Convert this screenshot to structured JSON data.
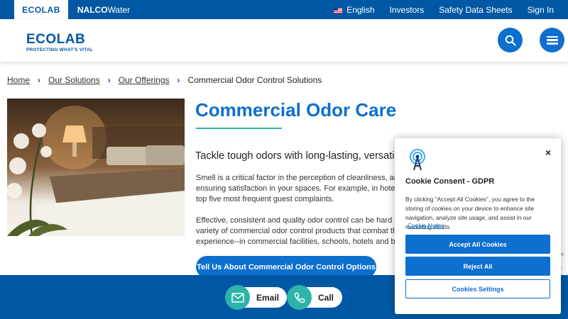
{
  "topbar": {
    "brands": [
      "ECOLAB",
      "NALCO",
      "Water"
    ],
    "links": [
      "English",
      "Investors",
      "Safety Data Sheets",
      "Sign In"
    ]
  },
  "header": {
    "logo_word": "ECOLAB",
    "logo_tagline": "PROTECTING WHAT'S VITAL"
  },
  "breadcrumb": [
    "Home",
    "Our Solutions",
    "Our Offerings",
    "Commercial Odor Control Solutions"
  ],
  "main": {
    "title": "Commercial Odor Care",
    "subtitle": "Tackle tough odors with long-lasting, versatile oc",
    "para1": [
      "Smell is a critical factor in the perception of cleanliness, and",
      "ensuring satisfaction in your spaces. For example, in hotel a",
      "top five most frequent guest complaints."
    ],
    "para2": [
      "Effective, consistent and quality odor control can be hard to",
      "variety of commercial odor control products that combat the",
      "experience--in commercial facilities, schools, hotels and beyo"
    ],
    "cta_label": "Tell Us About Commercial Odor Control Options"
  },
  "contact": {
    "email_label": "Email",
    "call_label": "Call"
  },
  "cookie_dialog": {
    "close_glyph": "×",
    "title": "Cookie Consent - GDPR",
    "text": "By clicking “Accept All Cookies”, you agree to the storing of cookies on your device to enhance site navigation, analyze site usage, and assist in our marketing efforts.",
    "notice_link": "Cookie Notice",
    "accept_label": "Accept All Cookies",
    "reject_label": "Reject All",
    "settings_label": "Cookies Settings"
  },
  "edge_fragments": [
    "e",
    "-"
  ],
  "colors": {
    "brand_blue": "#0058a4",
    "button_blue": "#0d6fce",
    "accent_teal": "#2db3a8"
  },
  "icons": [
    "us-flag-icon",
    "search-icon",
    "menu-icon",
    "envelope-icon",
    "phone-icon",
    "close-icon",
    "cookie-tower-icon"
  ]
}
